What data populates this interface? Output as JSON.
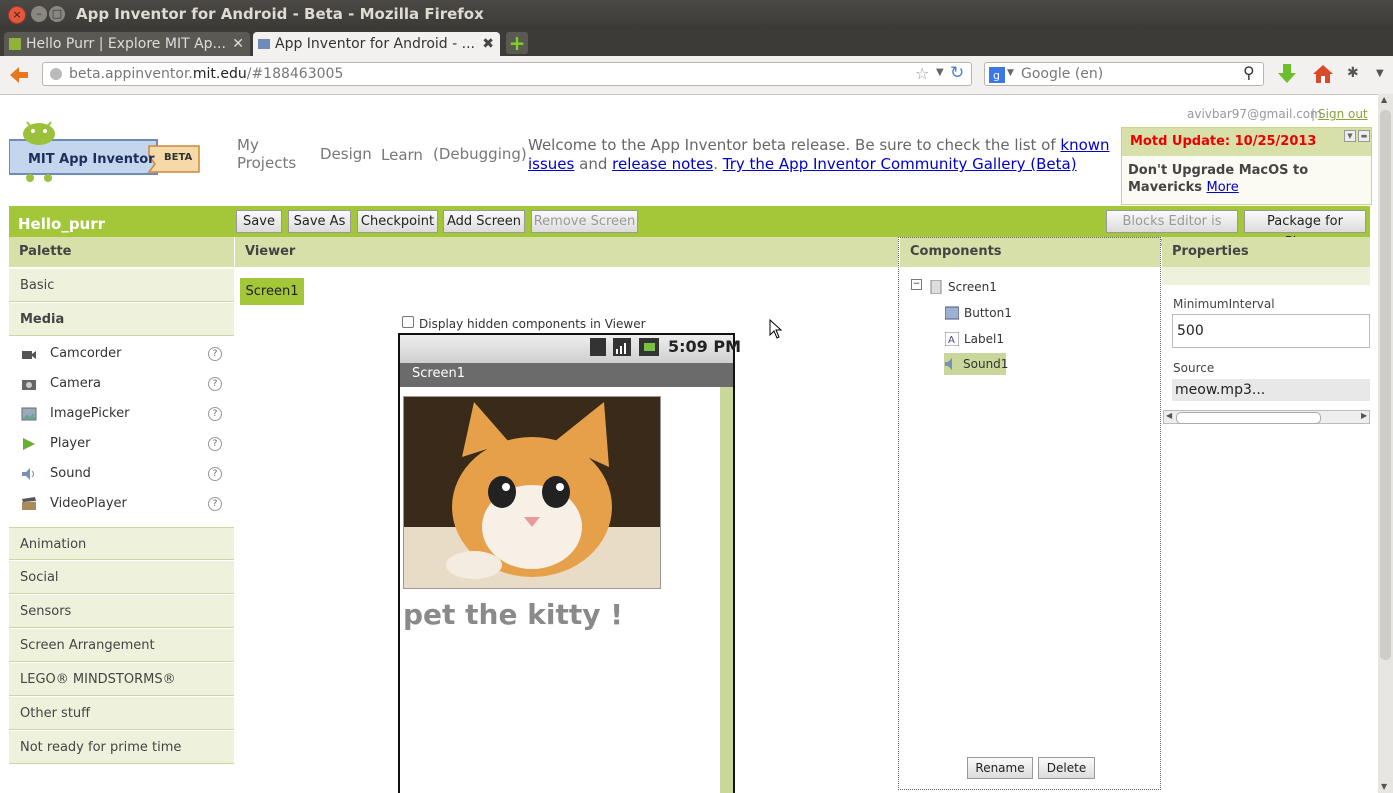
{
  "window": {
    "title": "App Inventor for Android - Beta - Mozilla Firefox",
    "tabs": [
      {
        "label": "Hello Purr | Explore MIT Ap..."
      },
      {
        "label": "App Inventor for Android - ..."
      }
    ],
    "url_prefix": "beta.appinventor.",
    "url_domain": "mit.edu",
    "url_suffix": "/#188463005",
    "search_placeholder": "Google (en)"
  },
  "header": {
    "logo_text": "MIT App Inventor",
    "beta_badge": "BETA",
    "nav": {
      "my_projects_line1": "My",
      "my_projects_line2": "Projects",
      "design": "Design",
      "learn": "Learn",
      "debugging": "(Debugging)"
    },
    "welcome_text1": "Welcome to the App Inventor beta release. Be sure to check the list of ",
    "known_issues": "known issues",
    "welcome_text2": " and ",
    "release_notes": "release notes",
    "welcome_text3": ". ",
    "gallery_link": "Try the App Inventor Community Gallery (Beta)",
    "account": "avivbar97@gmail.com",
    "separator": "|",
    "sign_out": "Sign out",
    "motd_title": "Motd Update: 10/25/2013",
    "motd_body": "Don't Upgrade MacOS to Mavericks ",
    "motd_more": "More"
  },
  "project": {
    "name": "Hello_purr",
    "buttons": {
      "save": "Save",
      "save_as": "Save As",
      "checkpoint": "Checkpoint",
      "add_screen": "Add Screen",
      "remove_screen": "Remove Screen",
      "blocks_editor": "Blocks Editor is open",
      "package": "Package for Phone"
    }
  },
  "palette": {
    "title": "Palette",
    "categories": {
      "basic": "Basic",
      "media": "Media",
      "animation": "Animation",
      "social": "Social",
      "sensors": "Sensors",
      "screen_arrangement": "Screen Arrangement",
      "lego": "LEGO® MINDSTORMS®",
      "other": "Other stuff",
      "not_ready": "Not ready for prime time"
    },
    "media_items": [
      "Camcorder",
      "Camera",
      "ImagePicker",
      "Player",
      "Sound",
      "VideoPlayer"
    ],
    "help_glyph": "?"
  },
  "viewer": {
    "title": "Viewer",
    "screen_tab": "Screen1",
    "hidden_label": "Display hidden components in Viewer",
    "clock": "5:09 PM",
    "screen_title": "Screen1",
    "label_text": "pet the kitty !"
  },
  "components": {
    "title": "Components",
    "tree": {
      "root": "Screen1",
      "children": [
        "Button1",
        "Label1",
        "Sound1"
      ]
    },
    "rename": "Rename",
    "delete": "Delete"
  },
  "properties": {
    "title": "Properties",
    "min_interval_label": "MinimumInterval",
    "min_interval_value": "500",
    "source_label": "Source",
    "source_value": "meow.mp3..."
  },
  "colors": {
    "accent_green": "#a4c639",
    "header_green": "#d7e0a8",
    "motd_red": "#ee0000"
  }
}
